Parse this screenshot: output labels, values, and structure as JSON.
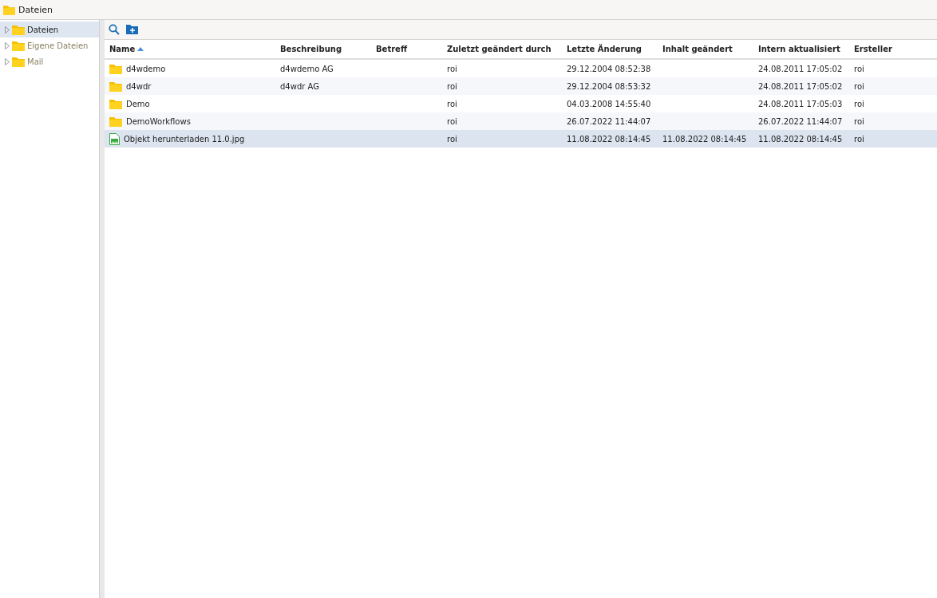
{
  "window": {
    "title": "Dateien"
  },
  "sidebar": {
    "items": [
      {
        "label": "Dateien",
        "selected": true,
        "expanded": false
      },
      {
        "label": "Eigene Dateien",
        "selected": false,
        "expanded": false
      },
      {
        "label": "Mail",
        "selected": false,
        "expanded": false
      }
    ]
  },
  "table": {
    "columns": [
      {
        "label": "Name",
        "sorted": true
      },
      {
        "label": "Beschreibung",
        "sorted": false
      },
      {
        "label": "Betreff",
        "sorted": false
      },
      {
        "label": "Zuletzt geändert durch",
        "sorted": false
      },
      {
        "label": "Letzte Änderung",
        "sorted": false
      },
      {
        "label": "Inhalt geändert",
        "sorted": false
      },
      {
        "label": "Intern aktualisiert",
        "sorted": false
      },
      {
        "label": "Ersteller",
        "sorted": false
      }
    ],
    "rows": [
      {
        "kind": "folder",
        "selected": false,
        "cells": [
          "d4wdemo",
          "d4wdemo AG",
          "",
          "roi",
          "29.12.2004 08:52:38",
          "",
          "24.08.2011 17:05:02",
          "roi"
        ]
      },
      {
        "kind": "folder",
        "selected": false,
        "cells": [
          "d4wdr",
          "d4wdr AG",
          "",
          "roi",
          "29.12.2004 08:53:32",
          "",
          "24.08.2011 17:05:02",
          "roi"
        ]
      },
      {
        "kind": "folder",
        "selected": false,
        "cells": [
          "Demo",
          "",
          "",
          "roi",
          "04.03.2008 14:55:40",
          "",
          "24.08.2011 17:05:03",
          "roi"
        ]
      },
      {
        "kind": "folder",
        "selected": false,
        "cells": [
          "DemoWorkflows",
          "",
          "",
          "roi",
          "26.07.2022 11:44:07",
          "",
          "26.07.2022 11:44:07",
          "roi"
        ]
      },
      {
        "kind": "image",
        "selected": true,
        "cells": [
          "Objekt herunterladen 11.0.jpg",
          "",
          "",
          "roi",
          "11.08.2022 08:14:45",
          "11.08.2022 08:14:45",
          "11.08.2022 08:14:45",
          "roi"
        ]
      }
    ]
  }
}
